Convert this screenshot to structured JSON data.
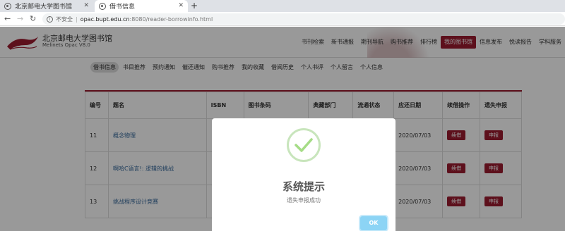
{
  "browser": {
    "tabs": [
      {
        "title": "北京邮电大学图书馆"
      },
      {
        "title": "借书信息"
      }
    ],
    "address": {
      "security_label": "不安全",
      "separator": "|",
      "host": "opac.bupt.edu.cn",
      "path": ":8080/reader-borrowinfo.html"
    }
  },
  "header": {
    "logo_title": "北京邮电大学图书馆",
    "logo_subtitle": "Melinets Opac V8.0",
    "nav": [
      "书刊检索",
      "新书通报",
      "期刊导航",
      "购书推荐",
      "排行榜",
      "我的图书馆",
      "信息发布",
      "悦读报告",
      "学科服务"
    ],
    "nav_active": "我的图书馆"
  },
  "subnav": {
    "items": [
      "借书信息",
      "书目推荐",
      "预约通知",
      "催还通知",
      "购书推荐",
      "我的收藏",
      "借阅历史",
      "个人书评",
      "个人留言",
      "个人信息"
    ]
  },
  "table": {
    "headers": [
      "编号",
      "题名",
      "ISBN",
      "图书条码",
      "典藏部门",
      "流通状态",
      "应还日期",
      "续借操作",
      "遗失申报"
    ],
    "rows": [
      {
        "no": "11",
        "title": "概念物理",
        "due": "2020/07/03",
        "renew": "续借",
        "report": "申报"
      },
      {
        "no": "12",
        "title": "啊哈C语言!: 逻辑的挑战",
        "due": "2020/07/03",
        "renew": "续借",
        "report": "申报"
      },
      {
        "no": "13",
        "title": "挑战程序设计竞赛",
        "due": "2020/07/03",
        "renew": "续借",
        "report": "申报"
      }
    ]
  },
  "modal": {
    "title": "系统提示",
    "message": "遗失申报成功",
    "ok_label": "OK"
  },
  "colors": {
    "brand": "#9b1b30",
    "ok_button": "#8cd4f5",
    "success_ring": "#c8e5bc",
    "success_check": "#a5dc86"
  }
}
